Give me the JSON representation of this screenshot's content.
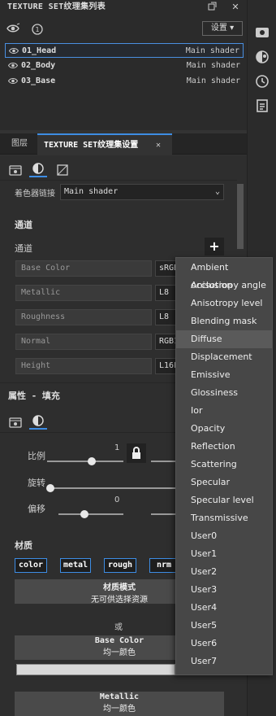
{
  "texture_set_list": {
    "title": "TEXTURE SET纹理集列表",
    "settings_label": "设置 ▾",
    "rows": [
      {
        "name": "01_Head",
        "shader": "Main shader"
      },
      {
        "name": "02_Body",
        "shader": "Main shader"
      },
      {
        "name": "03_Base",
        "shader": "Main shader"
      }
    ]
  },
  "settings_panel": {
    "tabs": [
      "图层",
      "TEXTURE SET纹理集设置"
    ],
    "shader_link_label": "着色器链接",
    "shader_link_value": "Main shader",
    "channels_section": "通道",
    "channel_label": "通道",
    "channels": [
      {
        "name": "Base Color",
        "format": "sRGB"
      },
      {
        "name": "Metallic",
        "format": "L8"
      },
      {
        "name": "Roughness",
        "format": "L8"
      },
      {
        "name": "Normal",
        "format": "RGB1"
      },
      {
        "name": "Height",
        "format": "L16F"
      }
    ]
  },
  "properties": {
    "title": "属性 - 填充",
    "scale_label": "比例",
    "scale_value": "1",
    "rotation_label": "旋转",
    "offset_label": "偏移",
    "offset_value": "0",
    "material_section": "材质",
    "channel_chips": [
      "color",
      "metal",
      "rough",
      "nrm"
    ],
    "material_mode_title": "材质模式",
    "material_mode_sub": "无可供选择资源",
    "or_label": "或",
    "base_color_title": "Base Color",
    "base_color_sub": "均一颜色",
    "metallic_title": "Metallic",
    "metallic_sub": "均一颜色"
  },
  "dropdown": {
    "items": [
      "Ambient occlusion",
      "Anisotropy angle",
      "Anisotropy level",
      "Blending mask",
      "Diffuse",
      "Displacement",
      "Emissive",
      "Glossiness",
      "Ior",
      "Opacity",
      "Reflection",
      "Scattering",
      "Specular",
      "Specular level",
      "Transmissive",
      "User0",
      "User1",
      "User2",
      "User3",
      "User4",
      "User5",
      "User6",
      "User7"
    ],
    "highlighted": "Diffuse"
  },
  "colors": {
    "accent": "#3d8de4",
    "panel": "#333333",
    "dropdown": "#474747"
  }
}
